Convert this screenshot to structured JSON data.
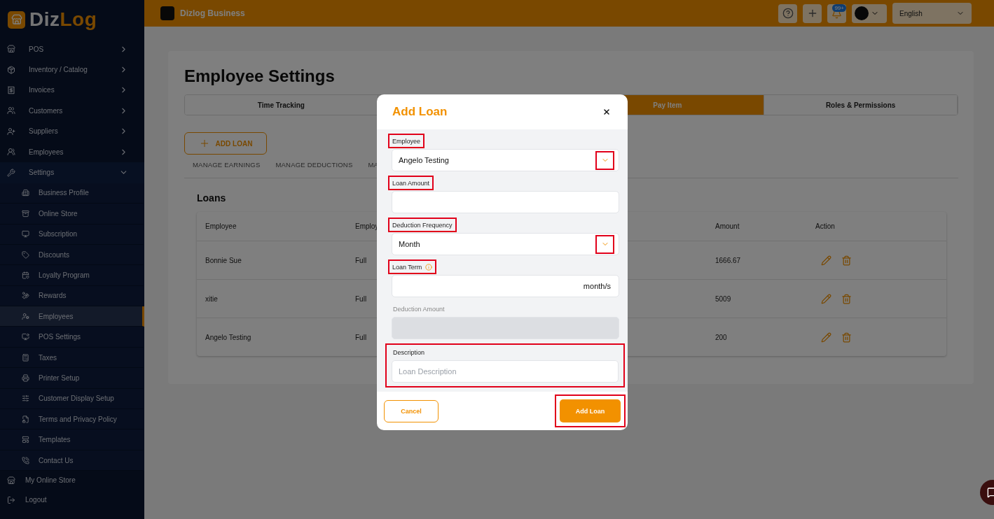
{
  "sidebar": {
    "brand": {
      "first": "Diz",
      "second": "Log"
    },
    "items": [
      {
        "label": "POS",
        "expanded": false,
        "selected": false
      },
      {
        "label": "Inventory / Catalog",
        "expanded": false,
        "selected": false
      },
      {
        "label": "Invoices",
        "expanded": false,
        "selected": false
      },
      {
        "label": "Customers",
        "expanded": false,
        "selected": false
      },
      {
        "label": "Suppliers",
        "expanded": false,
        "selected": false
      },
      {
        "label": "Employees",
        "expanded": false,
        "selected": false
      },
      {
        "label": "Settings",
        "expanded": true,
        "selected": false,
        "children": [
          {
            "label": "Business Profile",
            "selected": false
          },
          {
            "label": "Online Store",
            "selected": false
          },
          {
            "label": "Subscription",
            "selected": false
          },
          {
            "label": "Discounts",
            "selected": false
          },
          {
            "label": "Loyalty Program",
            "selected": false
          },
          {
            "label": "Rewards",
            "selected": false
          },
          {
            "label": "Employees",
            "selected": true
          },
          {
            "label": "POS Settings",
            "selected": false
          },
          {
            "label": "Taxes",
            "selected": false
          },
          {
            "label": "Printer Setup",
            "selected": false
          },
          {
            "label": "Customer Display Setup",
            "selected": false
          },
          {
            "label": "Terms and Privacy Policy",
            "selected": false
          },
          {
            "label": "Templates",
            "selected": false
          },
          {
            "label": "Contact Us",
            "selected": false
          }
        ]
      }
    ],
    "footer": [
      {
        "label": "My Online Store"
      },
      {
        "label": "Logout"
      }
    ]
  },
  "topbar": {
    "business": "Dizlog Business",
    "notification_badge": "99+",
    "language": "English"
  },
  "page": {
    "title": "Employee Settings",
    "tabs": [
      {
        "kind": "tab",
        "label": "Time Tracking",
        "selected": false
      },
      {
        "kind": "covered"
      },
      {
        "kind": "tab",
        "label": "Pay Item",
        "selected": true
      },
      {
        "kind": "tab",
        "label": "Roles & Permissions",
        "selected": false
      }
    ],
    "add_button": "ADD LOAN",
    "subtabs": [
      "MANAGE EARNINGS",
      "MANAGE DEDUCTIONS",
      "MA"
    ],
    "section_title": "Loans",
    "table": {
      "columns": [
        "Employee",
        "Employ",
        "Amount",
        "Action"
      ],
      "rows": [
        {
          "employee": "Bonnie Sue",
          "employ": "Full",
          "amount": "1666.67"
        },
        {
          "employee": "xitie",
          "employ": "Full",
          "amount": "5009"
        },
        {
          "employee": "Angelo Testing",
          "employ": "Full",
          "amount": "200"
        }
      ]
    }
  },
  "modal": {
    "title": "Add Loan",
    "fields": [
      {
        "kind": "select",
        "label": "Employee",
        "value": "Angelo Testing",
        "annotated": true,
        "disabled": false
      },
      {
        "kind": "text",
        "label": "Loan Amount",
        "annotated": true,
        "disabled": false
      },
      {
        "kind": "select",
        "label": "Deduction Frequency",
        "value": "Month",
        "annotated": true,
        "disabled": false
      },
      {
        "kind": "suffix",
        "label": "Loan Term",
        "suffix": "month/s",
        "info": true,
        "annotated": true,
        "disabled": false
      },
      {
        "kind": "text",
        "label": "Deduction Amount",
        "annotated": false,
        "disabled": true
      },
      {
        "kind": "group",
        "label": "Description",
        "placeholder": "Loan Description",
        "annotated": true,
        "disabled": false
      }
    ],
    "cancel": "Cancel",
    "submit": "Add Loan",
    "submit_annotated": true
  }
}
